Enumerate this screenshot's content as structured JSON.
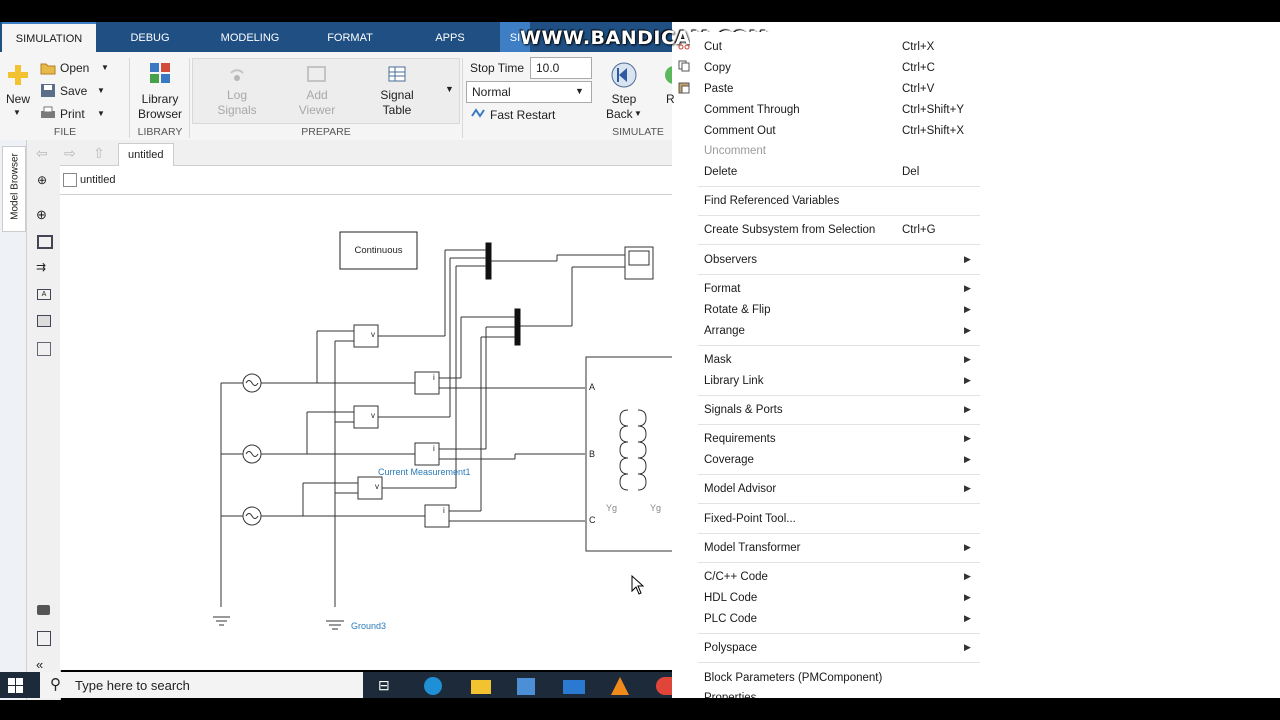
{
  "watermark": "WWW.BANDICAM.COM",
  "ribbon": {
    "tabs": [
      "SIMULATION",
      "DEBUG",
      "MODELING",
      "FORMAT",
      "APPS",
      "SI"
    ],
    "file": {
      "new": "New",
      "open": "Open",
      "save": "Save",
      "print": "Print",
      "group": "FILE"
    },
    "library": {
      "line1": "Library",
      "line2": "Browser",
      "group": "LIBRARY"
    },
    "prepare": {
      "log1": "Log",
      "log2": "Signals",
      "add1": "Add",
      "add2": "Viewer",
      "sig1": "Signal",
      "sig2": "Table",
      "group": "PREPARE"
    },
    "simulate": {
      "stop_time_label": "Stop Time",
      "stop_time_value": "10.0",
      "mode": "Normal",
      "fast_restart": "Fast Restart",
      "step1": "Step",
      "step2": "Back",
      "cut_r": "R",
      "group": "SIMULATE"
    }
  },
  "model_browser_label": "Model Browser",
  "tab_label": "untitled",
  "breadcrumb": "untitled",
  "diagram": {
    "continuous": "Continuous",
    "current_measurement": "Current Measurement1",
    "ground": "Ground3",
    "ports": [
      "A",
      "B",
      "C"
    ],
    "winding": [
      "Yg",
      "Yg"
    ],
    "v": "v",
    "i": "i"
  },
  "taskbar": {
    "search_placeholder": "Type here to search"
  },
  "context_menu": {
    "items": [
      {
        "label": "Cut",
        "shortcut": "Ctrl+X"
      },
      {
        "label": "Copy",
        "shortcut": "Ctrl+C"
      },
      {
        "label": "Paste",
        "shortcut": "Ctrl+V"
      },
      {
        "label": "Comment Through",
        "shortcut": "Ctrl+Shift+Y"
      },
      {
        "label": "Comment Out",
        "shortcut": "Ctrl+Shift+X"
      },
      {
        "label": "Uncomment",
        "shortcut": ""
      },
      {
        "label": "Delete",
        "shortcut": "Del"
      },
      {
        "label": "Find Referenced Variables",
        "shortcut": ""
      },
      {
        "label": "Create Subsystem from Selection",
        "shortcut": "Ctrl+G"
      },
      {
        "label": "Observers",
        "shortcut": ""
      },
      {
        "label": "Format",
        "shortcut": ""
      },
      {
        "label": "Rotate & Flip",
        "shortcut": ""
      },
      {
        "label": "Arrange",
        "shortcut": ""
      },
      {
        "label": "Mask",
        "shortcut": ""
      },
      {
        "label": "Library Link",
        "shortcut": ""
      },
      {
        "label": "Signals & Ports",
        "shortcut": ""
      },
      {
        "label": "Requirements",
        "shortcut": ""
      },
      {
        "label": "Coverage",
        "shortcut": ""
      },
      {
        "label": "Model Advisor",
        "shortcut": ""
      },
      {
        "label": "Fixed-Point Tool...",
        "shortcut": ""
      },
      {
        "label": "Model Transformer",
        "shortcut": ""
      },
      {
        "label": "C/C++ Code",
        "shortcut": ""
      },
      {
        "label": "HDL Code",
        "shortcut": ""
      },
      {
        "label": "PLC Code",
        "shortcut": ""
      },
      {
        "label": "Polyspace",
        "shortcut": ""
      },
      {
        "label": "Block Parameters (PMComponent)",
        "shortcut": ""
      },
      {
        "label": "Properties...",
        "shortcut": ""
      }
    ]
  },
  "colors": {
    "ribbon_blue": "#1f4f83",
    "accent": "#3d7ec4"
  }
}
